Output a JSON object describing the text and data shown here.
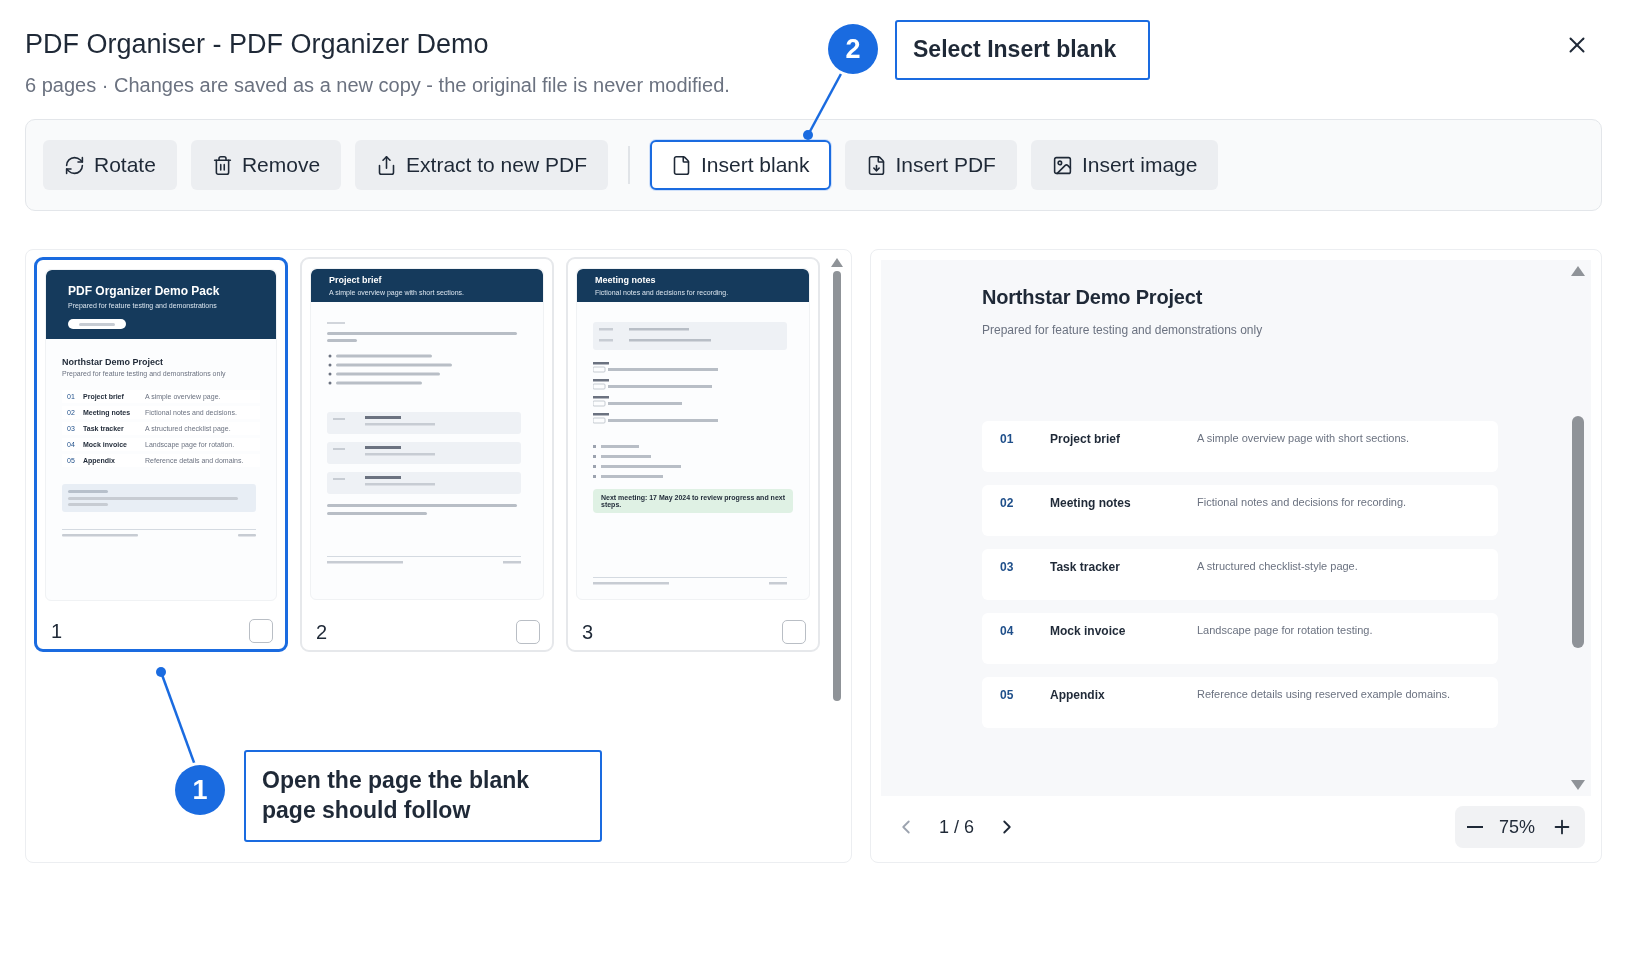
{
  "dialog": {
    "title": "PDF Organiser - PDF Organizer Demo",
    "subtitle": "6 pages · Changes are saved as a new copy - the original file is never modified."
  },
  "toolbar": {
    "edit_actions": [
      {
        "kind": "rotate",
        "label": "Rotate",
        "selected": false
      },
      {
        "kind": "remove",
        "label": "Remove",
        "selected": false
      },
      {
        "kind": "extract",
        "label": "Extract to new PDF",
        "selected": false
      }
    ],
    "insert_actions": [
      {
        "kind": "blank",
        "label": "Insert blank",
        "selected": true
      },
      {
        "kind": "pdf",
        "label": "Insert PDF",
        "selected": false
      },
      {
        "kind": "image",
        "label": "Insert image",
        "selected": false
      }
    ]
  },
  "thumbnails": [
    {
      "number": "1",
      "selected": true,
      "checked": false,
      "page": {
        "kind": "cover",
        "title": "PDF Organizer Demo Pack",
        "subtitle": "Prepared for feature testing and demonstrations",
        "heading": "Northstar Demo Project",
        "subheading": "Prepared for feature testing and demonstrations only",
        "rows": [
          {
            "num": "01",
            "name": "Project brief",
            "desc": "A simple overview page."
          },
          {
            "num": "02",
            "name": "Meeting notes",
            "desc": "Fictional notes and decisions."
          },
          {
            "num": "03",
            "name": "Task tracker",
            "desc": "A structured checklist page."
          },
          {
            "num": "04",
            "name": "Mock invoice",
            "desc": "Landscape page for rotation."
          },
          {
            "num": "05",
            "name": "Appendix",
            "desc": "Reference details and domains."
          }
        ]
      }
    },
    {
      "number": "2",
      "selected": false,
      "checked": false,
      "page": {
        "kind": "brief",
        "title": "Project brief",
        "subtitle": "A simple overview page with short sections."
      }
    },
    {
      "number": "3",
      "selected": false,
      "checked": false,
      "page": {
        "kind": "notes",
        "title": "Meeting notes",
        "subtitle": "Fictional notes and decisions for recording.",
        "note": "Next meeting: 17 May 2024 to review progress and next steps."
      }
    }
  ],
  "preview": {
    "title": "Northstar Demo Project",
    "subtitle": "Prepared for feature testing and demonstrations only",
    "rows": [
      {
        "num": "01",
        "name": "Project brief",
        "desc": "A simple overview page with short sections."
      },
      {
        "num": "02",
        "name": "Meeting notes",
        "desc": "Fictional notes and decisions for recording."
      },
      {
        "num": "03",
        "name": "Task tracker",
        "desc": "A structured checklist-style page."
      },
      {
        "num": "04",
        "name": "Mock invoice",
        "desc": "Landscape page for rotation testing."
      },
      {
        "num": "05",
        "name": "Appendix",
        "desc": "Reference details using reserved example domains."
      }
    ],
    "page_indicator": "1 / 6",
    "zoom": "75%"
  },
  "callouts": [
    {
      "number": "1",
      "text": "Open the page the blank page should follow"
    },
    {
      "number": "2",
      "text": "Select Insert blank"
    }
  ]
}
